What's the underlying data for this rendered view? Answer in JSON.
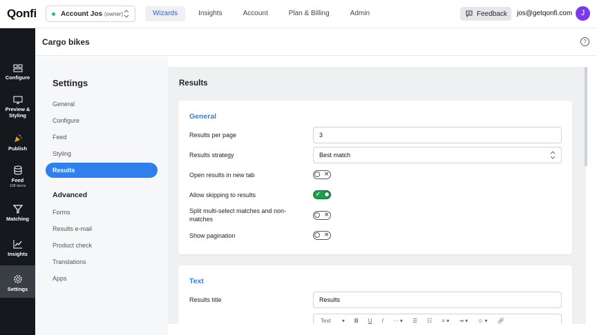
{
  "topbar": {
    "logo": "Qonfi",
    "account_name": "Account Jos",
    "account_role": "(owner)",
    "nav": [
      "Wizards",
      "Insights",
      "Account",
      "Plan & Billing",
      "Admin"
    ],
    "active_nav": "Wizards",
    "feedback_label": "Feedback",
    "email": "jos@getqonfi.com",
    "avatar_initial": "J"
  },
  "sidebar": {
    "items": [
      {
        "label": "Configure",
        "icon": "configure-icon"
      },
      {
        "label": "Preview & Styling",
        "icon": "monitor-icon"
      },
      {
        "label": "Publish",
        "icon": "party-popper-icon"
      },
      {
        "label": "Feed",
        "sub": "108 items",
        "icon": "database-icon"
      },
      {
        "label": "Matching",
        "icon": "filter-icon"
      },
      {
        "label": "Insights",
        "icon": "line-chart-icon"
      },
      {
        "label": "Settings",
        "icon": "gear-icon",
        "active": true
      }
    ]
  },
  "page": {
    "title": "Cargo bikes",
    "help": "?"
  },
  "settings_nav": {
    "heading": "Settings",
    "items": [
      "General",
      "Configure",
      "Feed",
      "Styling",
      "Results"
    ],
    "active": "Results",
    "advanced_heading": "Advanced",
    "advanced_items": [
      "Forms",
      "Results e-mail",
      "Product check",
      "Translations",
      "Apps"
    ]
  },
  "content": {
    "title": "Results",
    "general": {
      "title": "General",
      "results_per_page_label": "Results per page",
      "results_per_page_value": "3",
      "results_strategy_label": "Results strategy",
      "results_strategy_value": "Best match",
      "open_new_tab_label": "Open results in new tab",
      "open_new_tab_on": false,
      "allow_skipping_label": "Allow skipping to results",
      "allow_skipping_on": true,
      "split_label": "Split multi-select matches and non-matches",
      "split_on": false,
      "pagination_label": "Show pagination",
      "pagination_on": false
    },
    "text": {
      "title": "Text",
      "results_title_label": "Results title",
      "results_title_value": "Results",
      "toolbar_text_label": "Text"
    }
  },
  "colors": {
    "accent": "#2f80ed",
    "sidebar_bg": "#15181d",
    "toggle_on": "#16a34a"
  }
}
